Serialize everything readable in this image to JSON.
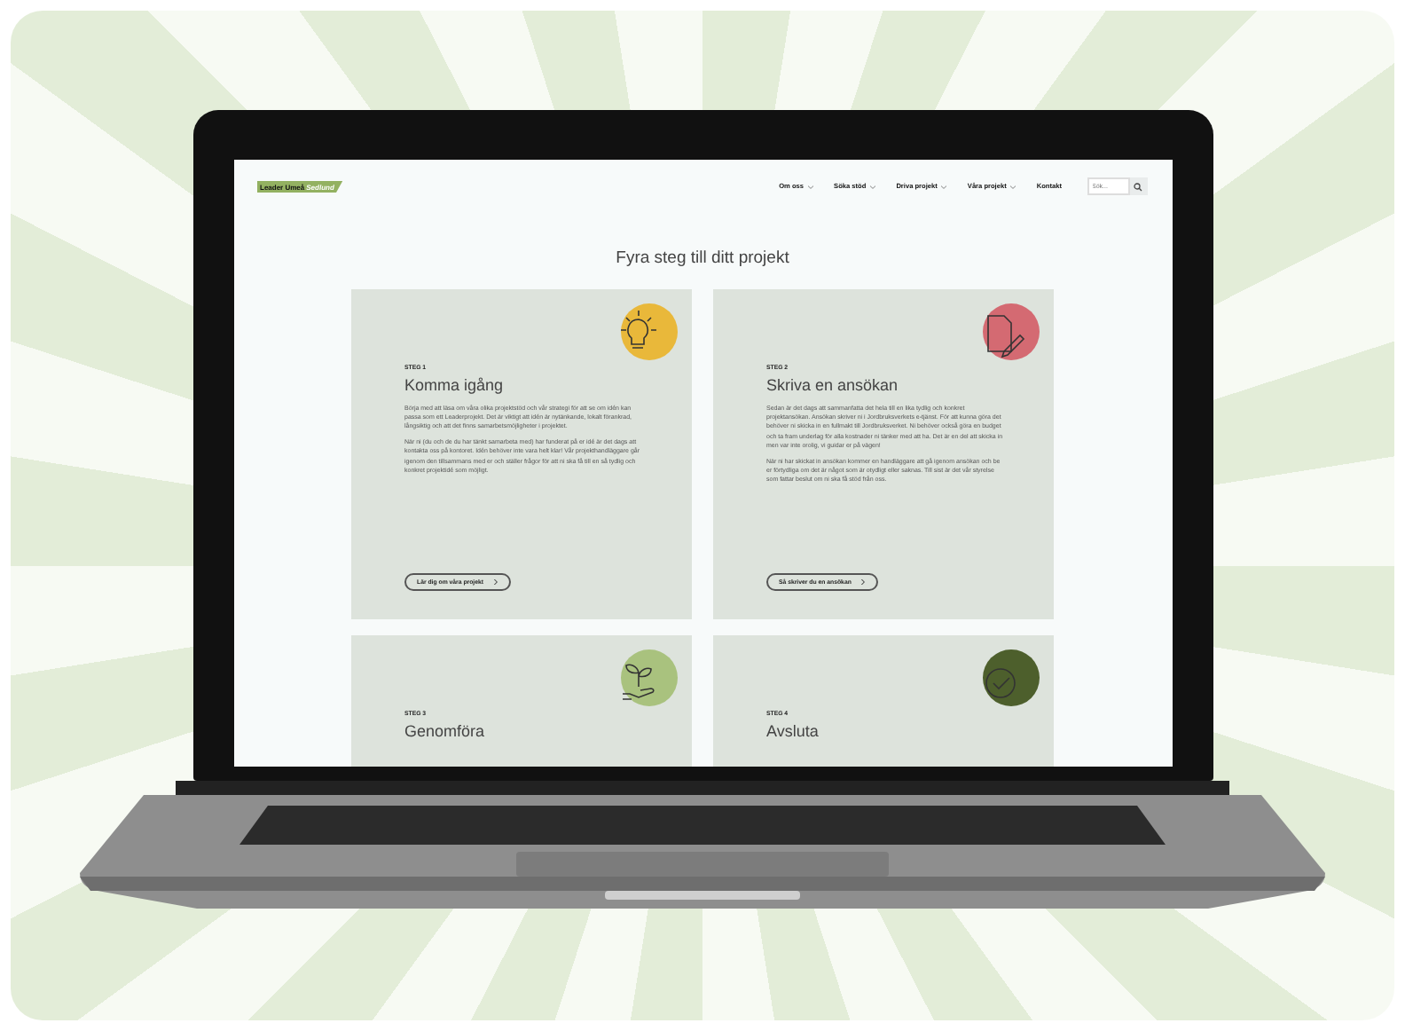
{
  "site": {
    "logo": {
      "primary": "Leader Umeå",
      "secondary": "Sedlund"
    },
    "nav": [
      {
        "label": "Om oss",
        "has_dropdown": true
      },
      {
        "label": "Söka stöd",
        "has_dropdown": true
      },
      {
        "label": "Driva projekt",
        "has_dropdown": true
      },
      {
        "label": "Våra projekt",
        "has_dropdown": true
      },
      {
        "label": "Kontakt",
        "has_dropdown": false
      }
    ],
    "search": {
      "placeholder": "Sök..."
    },
    "heading": "Fyra steg till ditt projekt",
    "steps": [
      {
        "step": "STEG 1",
        "title": "Komma igång",
        "kind": "bulb",
        "color": "#e9b83a",
        "paragraphs": [
          "Börja med att läsa om våra olika projektstöd och vår strategi för att se om idén kan passa som ett Leaderprojekt. Det är viktigt att idén är nytänkande, lokalt förankrad, långsiktig och att det finns samarbetsmöjligheter i projektet.",
          "När ni (du och de du har tänkt samarbeta med) har funderat på er idé är det dags att kontakta oss på kontoret. Idén behöver inte vara helt klar! Vår projekthandläggare går igenom den tillsammans med er och ställer frågor för att ni ska få till en så tydlig och konkret projektidé som möjligt."
        ],
        "button": "Lär dig om våra projekt"
      },
      {
        "step": "STEG 2",
        "title": "Skriva en ansökan",
        "kind": "document",
        "color": "#d46a72",
        "paragraphs": [
          "Sedan är det dags att sammanfatta det hela till en lika tydlig och konkret projektansökan. Ansökan skriver ni i Jordbruksverkets e-tjänst. För att kunna göra det behöver ni skicka in en fullmakt till Jordbruksverket. Ni behöver också göra en budget och ta fram underlag för alla kostnader ni tänker med att ha. Det är en del att skicka in men var inte orolig, vi guidar er på vägen!",
          "När ni har skickat in ansökan kommer en handläggare att gå igenom ansökan och be er förtydliga om det är något som är otydligt eller saknas. Till sist är det vår styrelse som fattar beslut om ni ska få stöd från oss."
        ],
        "button": "Så skriver du en ansökan"
      },
      {
        "step": "STEG 3",
        "title": "Genomföra",
        "kind": "plant",
        "color": "#a9c27e"
      },
      {
        "step": "STEG 4",
        "title": "Avsluta",
        "kind": "check",
        "color": "#4d5f2c"
      }
    ]
  }
}
